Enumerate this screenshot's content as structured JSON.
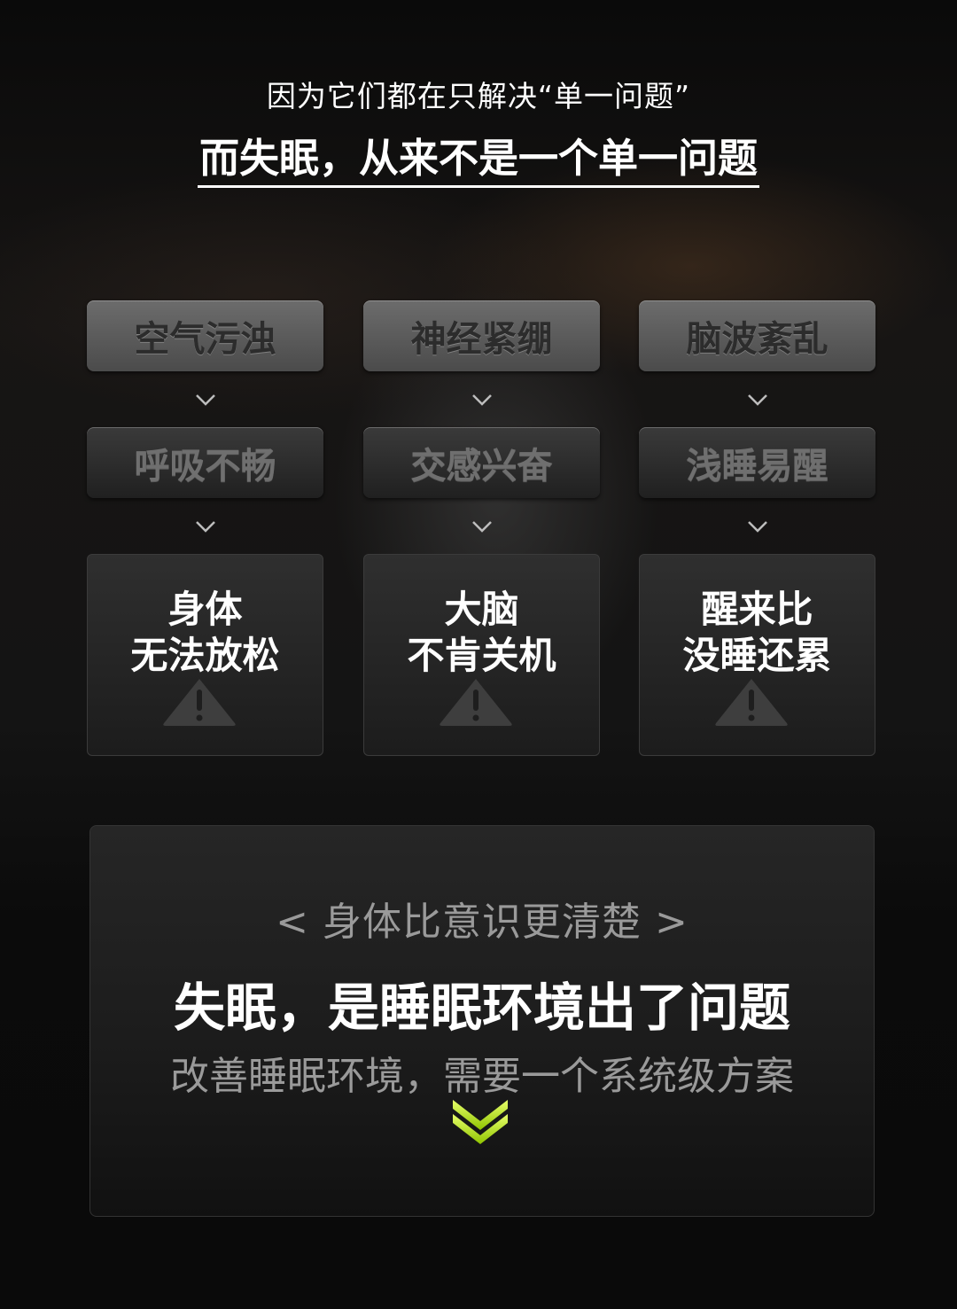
{
  "header": {
    "subtitle": "因为它们都在只解决“单一问题”",
    "title": "而失眠，从来不是一个单一问题"
  },
  "columns": [
    {
      "problem": "空气污浊",
      "effect": "呼吸不畅",
      "result_line1": "身体",
      "result_line2": "无法放松"
    },
    {
      "problem": "神经紧绷",
      "effect": "交感兴奋",
      "result_line1": "大脑",
      "result_line2": "不肯关机"
    },
    {
      "problem": "脑波紊乱",
      "effect": "浅睡易醒",
      "result_line1": "醒来比",
      "result_line2": "没睡还累"
    }
  ],
  "icons": {
    "chevron": "chevron-down-icon",
    "warning": "warning-icon",
    "arrows": "double-chevron-down-icon"
  },
  "panel": {
    "tag": "< 身体比意识更清楚 >",
    "title": "失眠，是睡眠环境出了问题",
    "subtitle": "改善睡眠环境，需要一个系统级方案"
  },
  "colors": {
    "background": "#0d0d0d",
    "accent": "#b6e800",
    "muted_text": "#9a9a9a"
  }
}
